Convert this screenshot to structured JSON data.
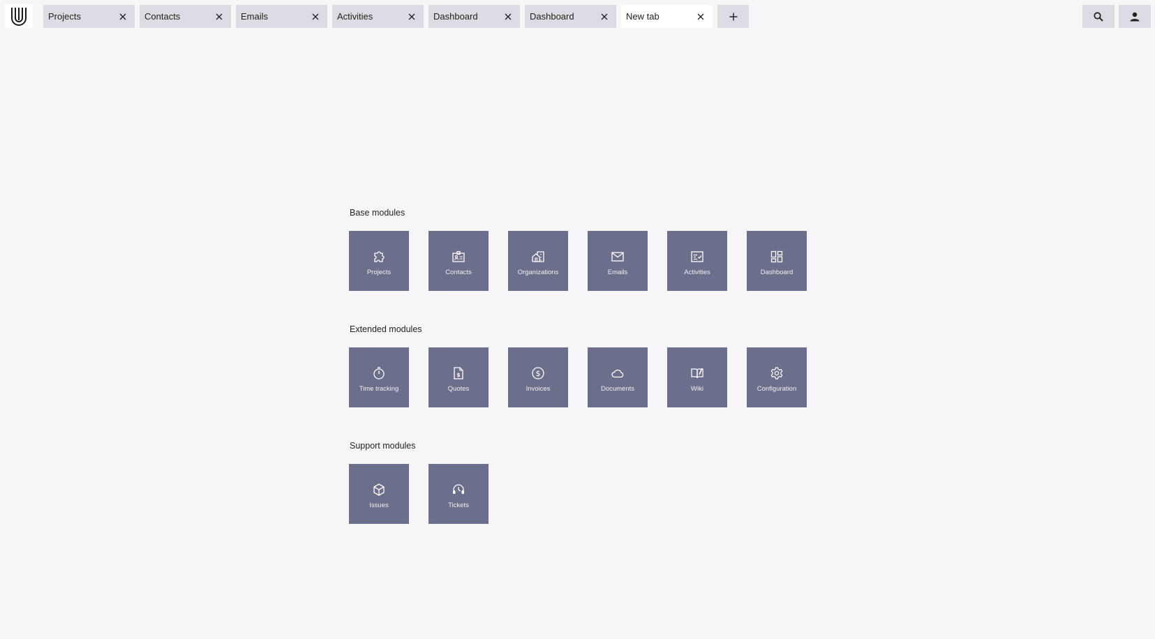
{
  "tabs": [
    {
      "label": "Projects"
    },
    {
      "label": "Contacts"
    },
    {
      "label": "Emails"
    },
    {
      "label": "Activities"
    },
    {
      "label": "Dashboard"
    },
    {
      "label": "Dashboard"
    },
    {
      "label": "New tab"
    }
  ],
  "sections": {
    "base": {
      "title": "Base modules",
      "tiles": [
        {
          "label": "Projects",
          "icon": "puzzle-icon"
        },
        {
          "label": "Contacts",
          "icon": "contact-card-icon"
        },
        {
          "label": "Organizations",
          "icon": "building-icon"
        },
        {
          "label": "Emails",
          "icon": "mail-icon"
        },
        {
          "label": "Activities",
          "icon": "checklist-icon"
        },
        {
          "label": "Dashboard",
          "icon": "dashboard-grid-icon"
        }
      ]
    },
    "extended": {
      "title": "Extended modules",
      "tiles": [
        {
          "label": "Time tracking",
          "icon": "stopwatch-icon"
        },
        {
          "label": "Quotes",
          "icon": "document-dollar-icon"
        },
        {
          "label": "Invoices",
          "icon": "dollar-circle-icon"
        },
        {
          "label": "Documents",
          "icon": "cloud-icon"
        },
        {
          "label": "Wiki",
          "icon": "book-icon"
        },
        {
          "label": "Configuration",
          "icon": "gear-icon"
        }
      ]
    },
    "support": {
      "title": "Support modules",
      "tiles": [
        {
          "label": "Issues",
          "icon": "cube-icon"
        },
        {
          "label": "Tickets",
          "icon": "headset-icon"
        }
      ]
    }
  },
  "colors": {
    "background": "#f6f6f8",
    "tab_inactive": "#dcdce4",
    "tab_active": "#ffffff",
    "tile": "#6b6f8b"
  }
}
